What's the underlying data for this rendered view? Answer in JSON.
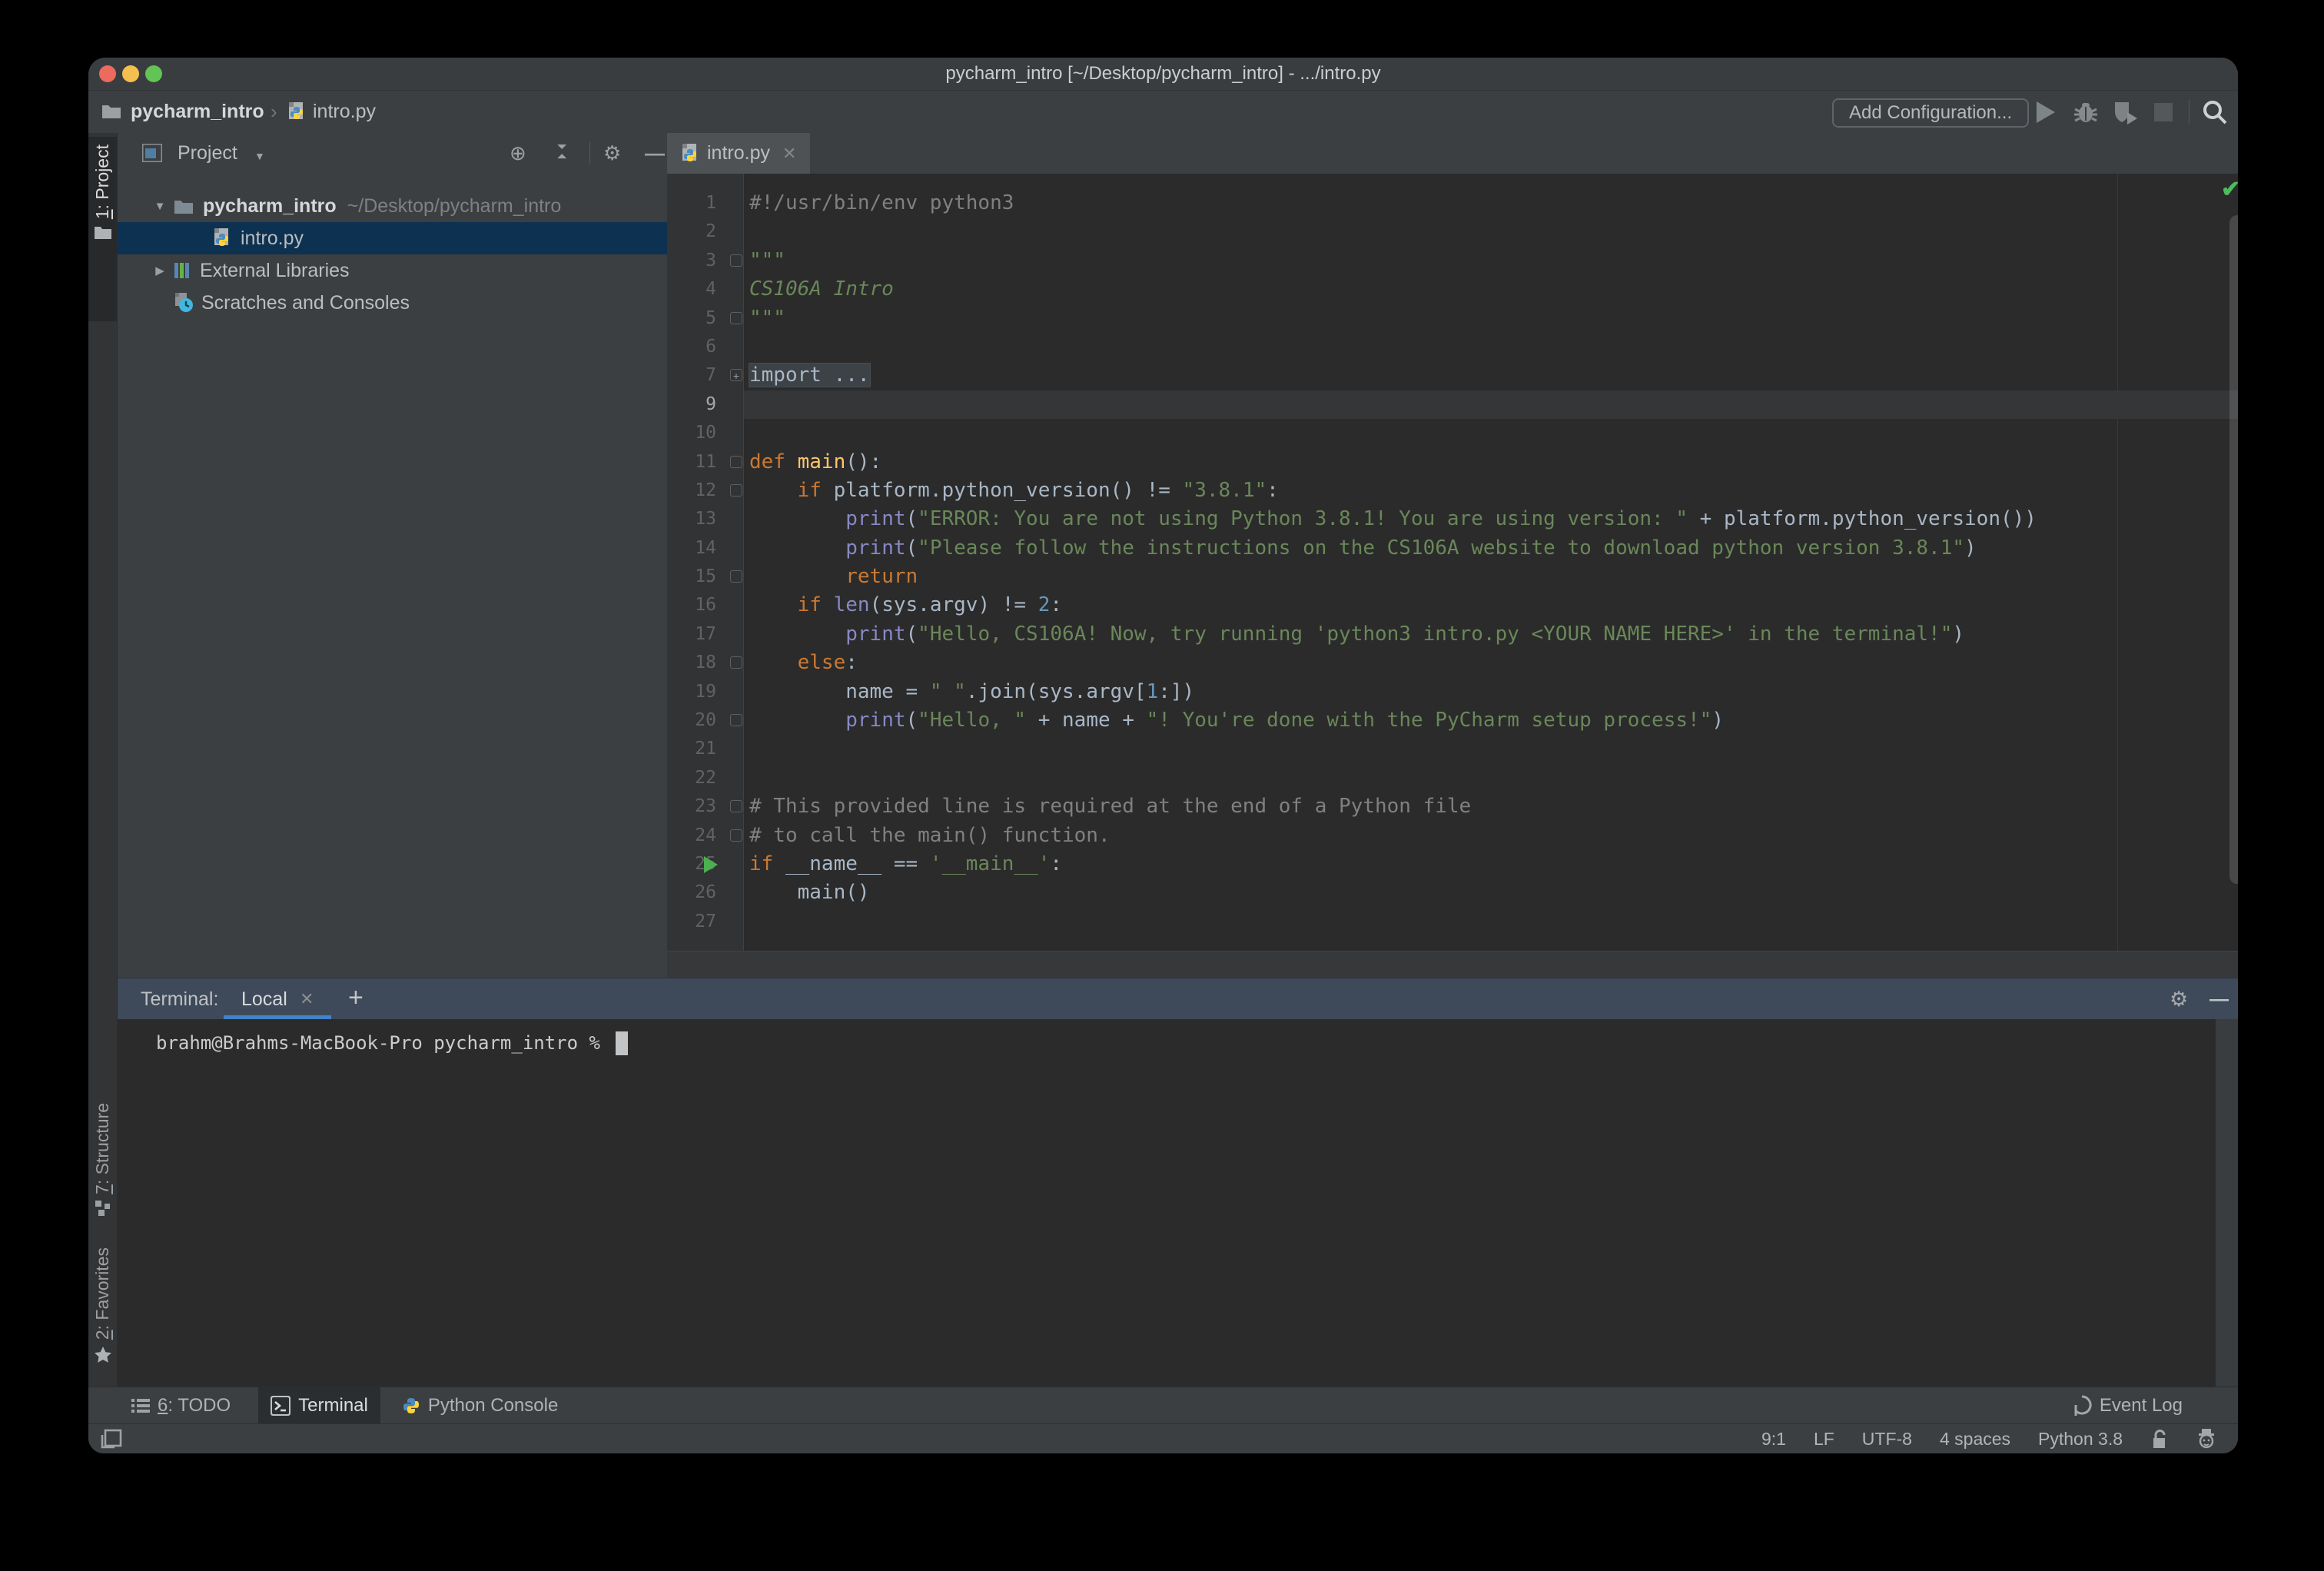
{
  "window": {
    "title": "pycharm_intro [~/Desktop/pycharm_intro] - .../intro.py"
  },
  "icons": {
    "caret_down": "▼",
    "caret_right": "▶",
    "chevron": "›",
    "check": "✔",
    "close": "✕",
    "plus": "+",
    "minus_bar": "—",
    "gear": "⚙",
    "locate": "⊕"
  },
  "breadcrumbs": {
    "project": "pycharm_intro",
    "file": "intro.py"
  },
  "toolbar": {
    "add_configuration": "Add Configuration..."
  },
  "stripe": {
    "project_num": "1",
    "project_rest": ": Project",
    "structure_num": "7",
    "structure_rest": ": Structure",
    "favorites_num": "2",
    "favorites_rest": ": Favorites"
  },
  "project_panel": {
    "header_title": "Project",
    "tree": [
      {
        "name": "pycharm_intro",
        "path": "~/Desktop/pycharm_intro"
      },
      {
        "name": "intro.py"
      },
      {
        "name": "External Libraries"
      },
      {
        "name": "Scratches and Consoles"
      }
    ]
  },
  "editor": {
    "tab": "intro.py",
    "fold_plus_glyph": "+",
    "palette": {
      "kw": "#CC7832",
      "str": "#6A8759",
      "stri": "#6A8759",
      "com": "#808080",
      "fn": "#FFC66D",
      "builtin": "#8888C6",
      "num": "#6897BB",
      "plain": "#A9B7C6",
      "fold": "#A9B7C6"
    },
    "lines": [
      {
        "n": "1",
        "tokens": [
          [
            "com",
            "#!/usr/bin/env python3"
          ]
        ]
      },
      {
        "n": "2",
        "tokens": []
      },
      {
        "n": "3",
        "fold": "start",
        "tokens": [
          [
            "stri",
            "\"\"\""
          ]
        ]
      },
      {
        "n": "4",
        "tokens": [
          [
            "stri",
            "CS106A Intro"
          ]
        ]
      },
      {
        "n": "5",
        "fold": "end",
        "tokens": [
          [
            "stri",
            "\"\"\""
          ]
        ]
      },
      {
        "n": "6",
        "tokens": []
      },
      {
        "n": "7",
        "fold": "plus",
        "tokens": [
          [
            "fold",
            "import ..."
          ]
        ]
      },
      {
        "n": "9",
        "caret": true,
        "tokens": []
      },
      {
        "n": "10",
        "tokens": []
      },
      {
        "n": "11",
        "fold": "start",
        "tokens": [
          [
            "kw",
            "def"
          ],
          [
            "plain",
            " "
          ],
          [
            "fn",
            "main"
          ],
          [
            "plain",
            "():"
          ]
        ]
      },
      {
        "n": "12",
        "fold": "start",
        "tokens": [
          [
            "plain",
            "    "
          ],
          [
            "kw",
            "if"
          ],
          [
            "plain",
            " platform.python_version() != "
          ],
          [
            "str",
            "\"3.8.1\""
          ],
          [
            "plain",
            ":"
          ]
        ]
      },
      {
        "n": "13",
        "tokens": [
          [
            "plain",
            "        "
          ],
          [
            "builtin",
            "print"
          ],
          [
            "plain",
            "("
          ],
          [
            "str",
            "\"ERROR: You are not using Python 3.8.1! You are using version: \""
          ],
          [
            "plain",
            " + platform.python_version())"
          ]
        ]
      },
      {
        "n": "14",
        "tokens": [
          [
            "plain",
            "        "
          ],
          [
            "builtin",
            "print"
          ],
          [
            "plain",
            "("
          ],
          [
            "str",
            "\"Please follow the instructions on the CS106A website to download python version 3.8.1\""
          ],
          [
            "plain",
            ")"
          ]
        ]
      },
      {
        "n": "15",
        "fold": "end",
        "tokens": [
          [
            "plain",
            "        "
          ],
          [
            "kw",
            "return"
          ]
        ]
      },
      {
        "n": "16",
        "tokens": [
          [
            "plain",
            "    "
          ],
          [
            "kw",
            "if"
          ],
          [
            "plain",
            " "
          ],
          [
            "builtin",
            "len"
          ],
          [
            "plain",
            "(sys.argv) != "
          ],
          [
            "num",
            "2"
          ],
          [
            "plain",
            ":"
          ]
        ]
      },
      {
        "n": "17",
        "tokens": [
          [
            "plain",
            "        "
          ],
          [
            "builtin",
            "print"
          ],
          [
            "plain",
            "("
          ],
          [
            "str",
            "\"Hello, CS106A! Now, try running 'python3 intro.py <YOUR NAME HERE>' in the terminal!\""
          ],
          [
            "plain",
            ")"
          ]
        ]
      },
      {
        "n": "18",
        "fold": "start",
        "tokens": [
          [
            "plain",
            "    "
          ],
          [
            "kw",
            "else"
          ],
          [
            "plain",
            ":"
          ]
        ]
      },
      {
        "n": "19",
        "tokens": [
          [
            "plain",
            "        name = "
          ],
          [
            "str",
            "\" \""
          ],
          [
            "plain",
            ".join(sys.argv["
          ],
          [
            "num",
            "1"
          ],
          [
            "plain",
            ":])"
          ]
        ]
      },
      {
        "n": "20",
        "fold": "end",
        "tokens": [
          [
            "plain",
            "        "
          ],
          [
            "builtin",
            "print"
          ],
          [
            "plain",
            "("
          ],
          [
            "str",
            "\"Hello, \""
          ],
          [
            "plain",
            " + name + "
          ],
          [
            "str",
            "\"! You're done with the PyCharm setup process!\""
          ],
          [
            "plain",
            ")"
          ]
        ]
      },
      {
        "n": "21",
        "tokens": []
      },
      {
        "n": "22",
        "tokens": []
      },
      {
        "n": "23",
        "fold": "start",
        "tokens": [
          [
            "com",
            "# This provided line is required at the end of a Python file"
          ]
        ]
      },
      {
        "n": "24",
        "fold": "end",
        "tokens": [
          [
            "com",
            "# to call the main() function."
          ]
        ]
      },
      {
        "n": "25",
        "run": true,
        "tokens": [
          [
            "kw",
            "if"
          ],
          [
            "plain",
            " __name__ == "
          ],
          [
            "str",
            "'__main__'"
          ],
          [
            "plain",
            ":"
          ]
        ]
      },
      {
        "n": "26",
        "tokens": [
          [
            "plain",
            "    main()"
          ]
        ]
      },
      {
        "n": "27",
        "tokens": []
      }
    ]
  },
  "terminal": {
    "label": "Terminal:",
    "tab": "Local",
    "prompt": "brahm@Brahms-MacBook-Pro pycharm_intro %"
  },
  "bottom_bar": {
    "todo_num": "6",
    "todo_rest": ": TODO",
    "terminal": "Terminal",
    "python_console": "Python Console",
    "event_log": "Event Log"
  },
  "status_bar": {
    "items": [
      "9:1",
      "LF",
      "UTF-8",
      "4 spaces",
      "Python 3.8"
    ]
  }
}
